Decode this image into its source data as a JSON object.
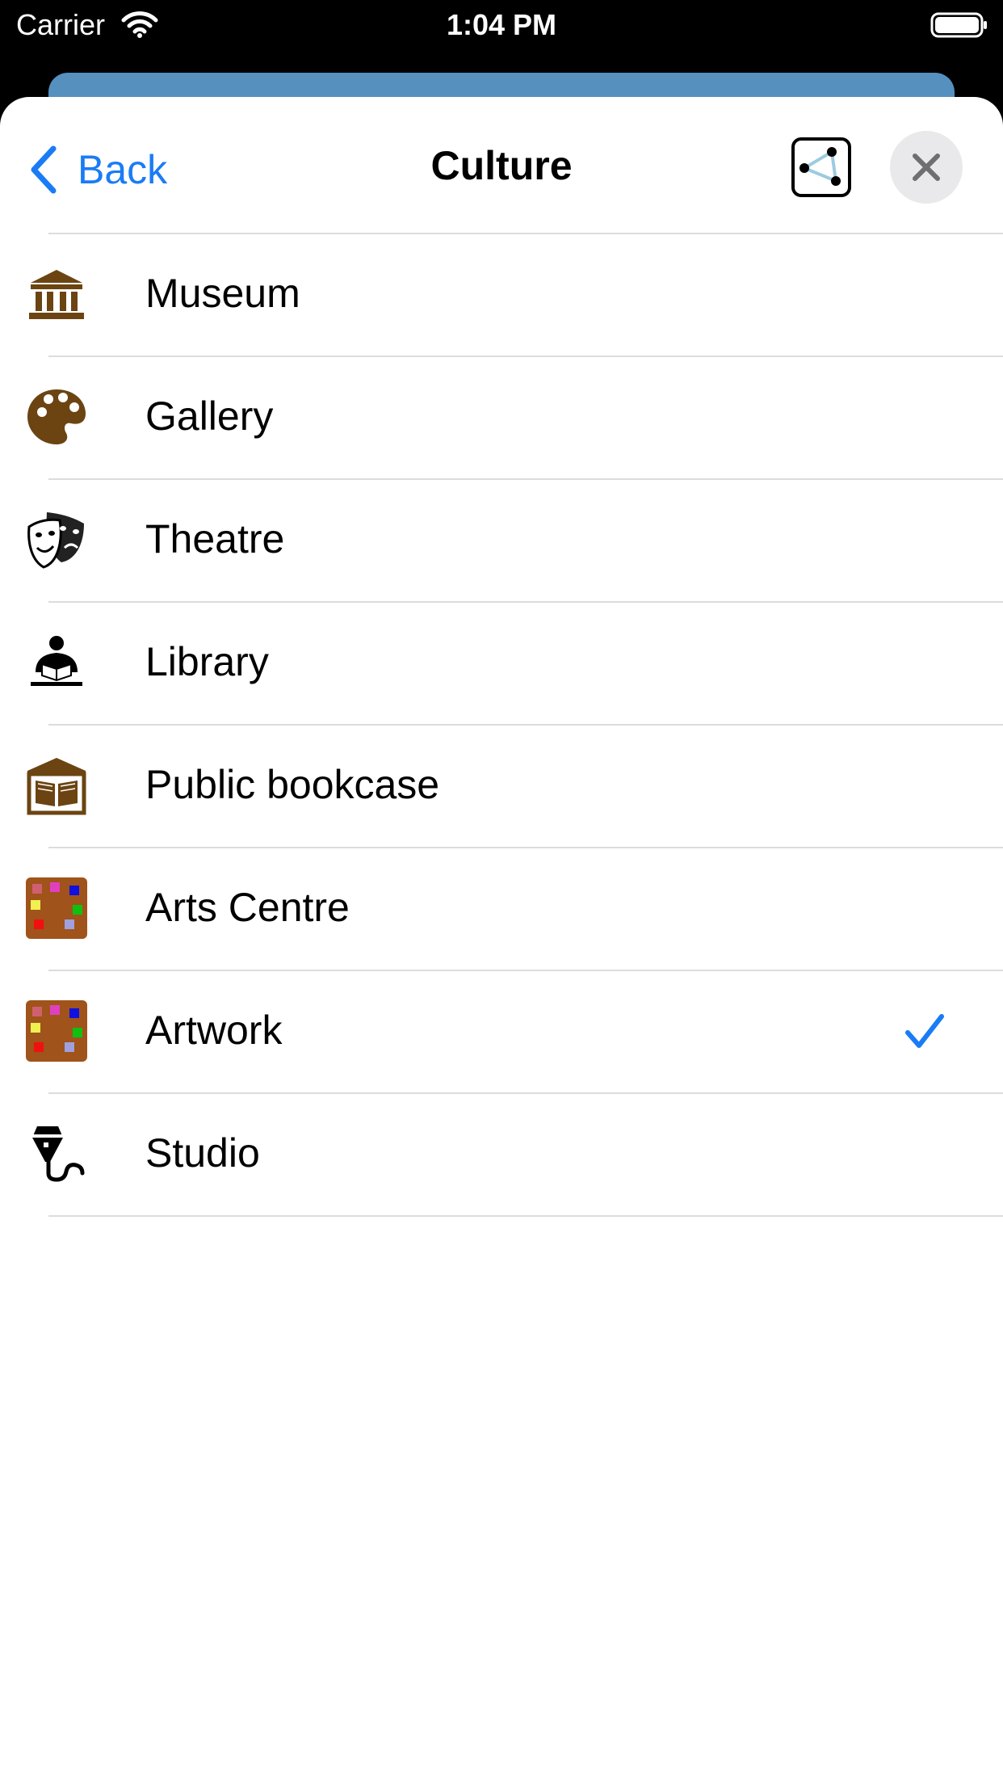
{
  "status_bar": {
    "carrier": "Carrier",
    "time": "1:04 PM"
  },
  "nav": {
    "back_label": "Back",
    "title": "Culture"
  },
  "items": [
    {
      "label": "Museum",
      "icon": "museum-icon",
      "selected": false
    },
    {
      "label": "Gallery",
      "icon": "palette-icon",
      "selected": false
    },
    {
      "label": "Theatre",
      "icon": "theatre-masks-icon",
      "selected": false
    },
    {
      "label": "Library",
      "icon": "library-reader-icon",
      "selected": false
    },
    {
      "label": "Public bookcase",
      "icon": "public-bookcase-icon",
      "selected": false
    },
    {
      "label": "Arts Centre",
      "icon": "arts-centre-icon",
      "selected": false
    },
    {
      "label": "Artwork",
      "icon": "artwork-icon",
      "selected": true
    },
    {
      "label": "Studio",
      "icon": "studio-microphone-icon",
      "selected": false
    }
  ],
  "colors": {
    "accent": "#1a7cf5",
    "icon_brown": "#6b4412",
    "separator": "#dcdce0"
  }
}
